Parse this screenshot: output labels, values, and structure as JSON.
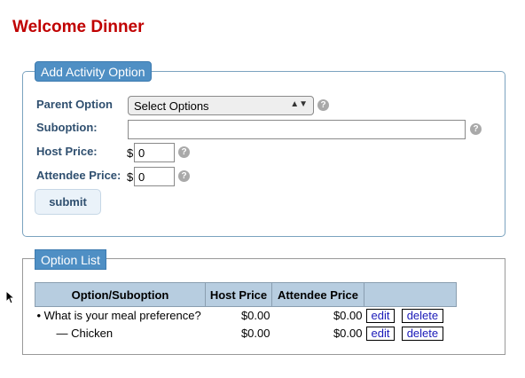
{
  "page": {
    "title": "Welcome Dinner"
  },
  "form": {
    "legend": "Add Activity Option",
    "parent_option_label": "Parent Option",
    "parent_option_value": "Select Options",
    "suboption_label": "Suboption:",
    "suboption_value": "",
    "host_price_label": "Host Price:",
    "host_price_value": "0",
    "attendee_price_label": "Attendee Price:",
    "attendee_price_value": "0",
    "currency": "$",
    "help_glyph": "?",
    "submit_label": "submit"
  },
  "option_list": {
    "legend": "Option List",
    "headers": [
      "Option/Suboption",
      "Host Price",
      "Attendee Price",
      ""
    ],
    "rows": [
      {
        "name": "• What is your meal preference?",
        "host_price": "$0.00",
        "attendee_price": "$0.00",
        "edit": "edit",
        "delete": "delete"
      },
      {
        "name": "— Chicken",
        "host_price": "$0.00",
        "attendee_price": "$0.00",
        "edit": "edit",
        "delete": "delete"
      }
    ]
  },
  "icons": {
    "help": "help-icon",
    "dropdown": "chevron-updown-icon",
    "cursor": "mouse-pointer-icon"
  },
  "colors": {
    "title": "#c00000",
    "legend_bg": "#4f8fc4",
    "label": "#2f4f6f",
    "table_header": "#b7cde0",
    "link": "#1a1ab8"
  }
}
